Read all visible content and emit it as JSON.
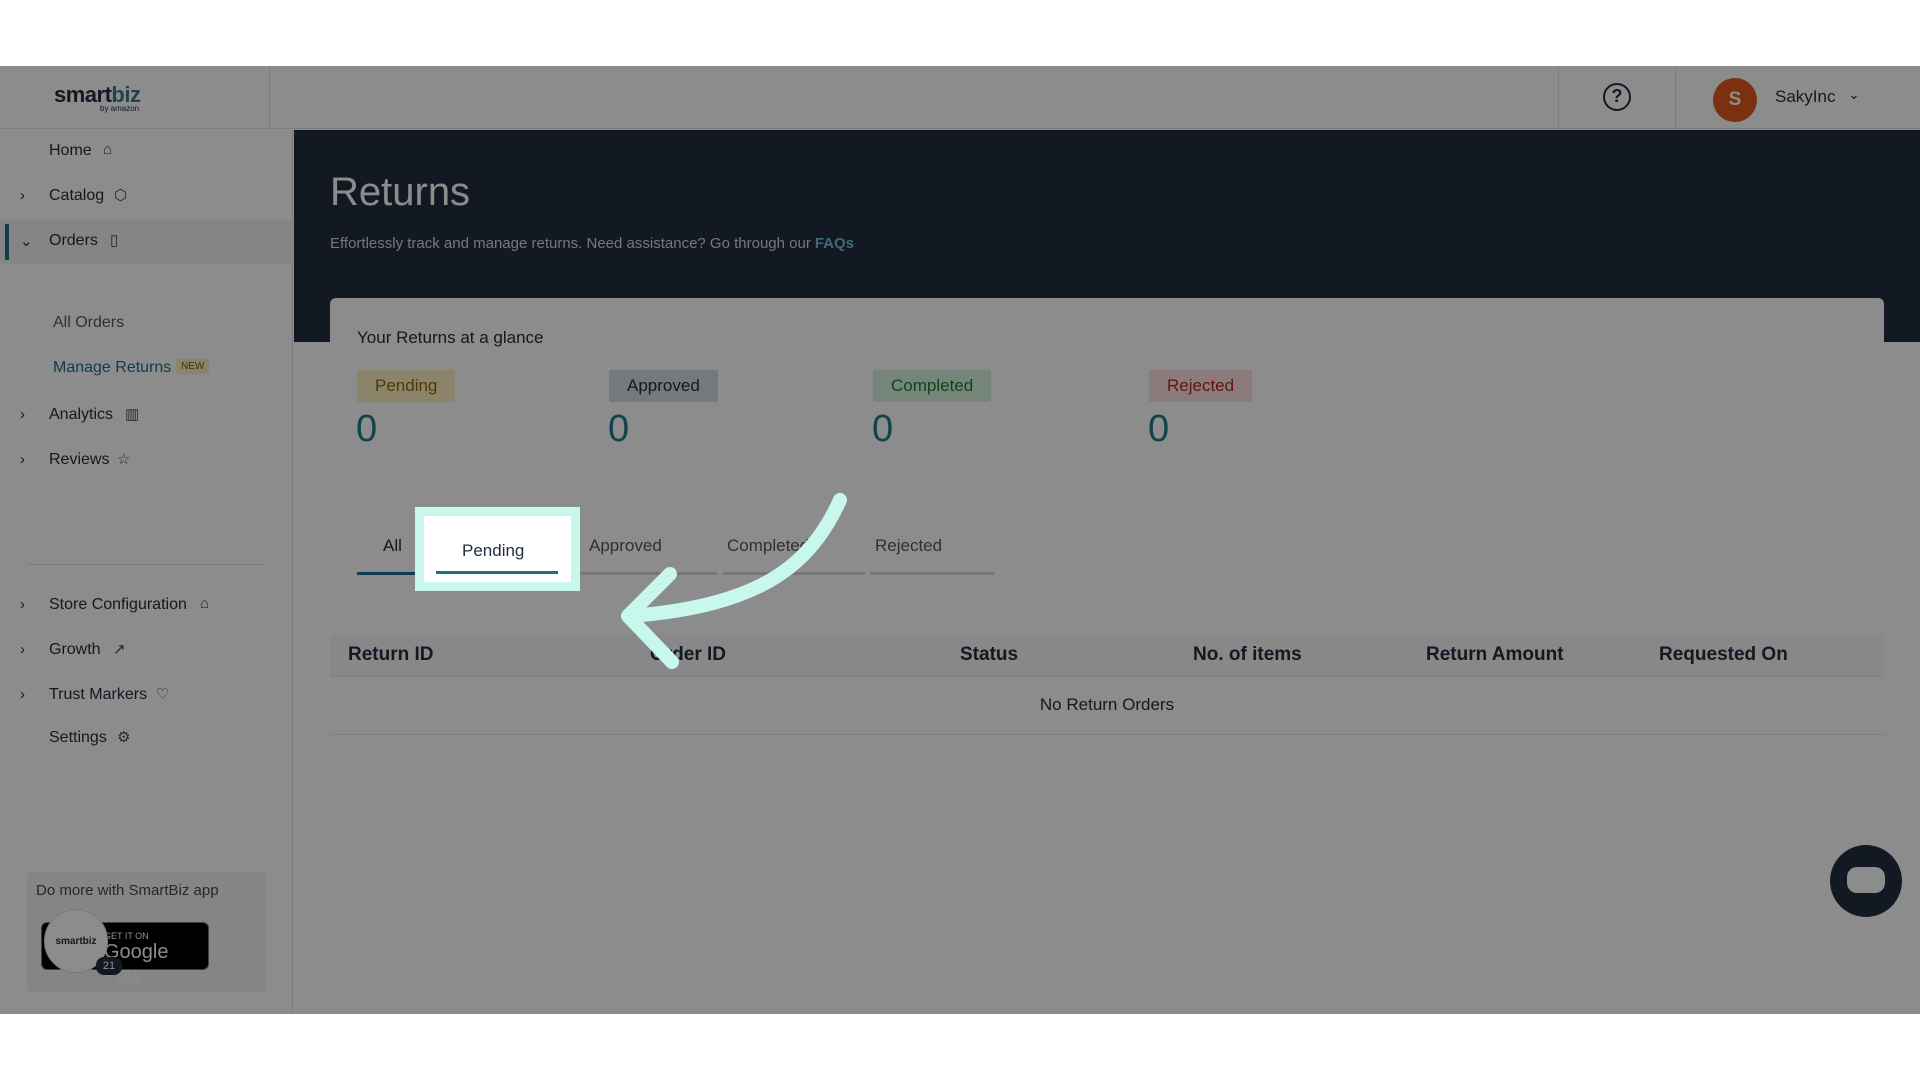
{
  "header": {
    "logo_main": "smart",
    "logo_accent": "biz",
    "logo_sub": "by amazon",
    "user_initial": "S",
    "user_name": "SakyInc"
  },
  "sidebar": {
    "items": [
      {
        "label": "Home",
        "icon": "home-icon"
      },
      {
        "label": "Catalog",
        "icon": "cube-icon"
      },
      {
        "label": "Orders",
        "icon": "clipboard-icon"
      },
      {
        "label": "Analytics",
        "icon": "bar-chart-icon"
      },
      {
        "label": "Reviews",
        "icon": "star-icon"
      },
      {
        "label": "Store Configuration",
        "icon": "store-icon"
      },
      {
        "label": "Growth",
        "icon": "trending-up-icon"
      },
      {
        "label": "Trust Markers",
        "icon": "shield-heart-icon"
      },
      {
        "label": "Settings",
        "icon": "gear-icon"
      }
    ],
    "sub_items": [
      "All Orders",
      "Manage Returns"
    ],
    "new_badge": "NEW",
    "app_promo": "Do more with SmartBiz app",
    "play_small": "GET IT ON",
    "play_big": "Google Play",
    "app_logo": "smartbiz",
    "app_count": "21"
  },
  "page": {
    "title": "Returns",
    "subtitle": "Effortlessly track and manage returns. Need assistance? Go through our",
    "faq_link": "FAQs"
  },
  "glance": {
    "title": "Your Returns at a glance",
    "stats": [
      {
        "label": "Pending",
        "value": "0",
        "color": "#fdf0c2"
      },
      {
        "label": "Approved",
        "value": "0",
        "color": "#d5dbe4"
      },
      {
        "label": "Completed",
        "value": "0",
        "color": "#d8f2dc"
      },
      {
        "label": "Rejected",
        "value": "0",
        "color": "#fde0e0"
      }
    ]
  },
  "tabs": [
    "All",
    "Pending",
    "Approved",
    "Completed",
    "Rejected"
  ],
  "table": {
    "columns": [
      "Return ID",
      "Order ID",
      "Status",
      "No. of items",
      "Return Amount",
      "Requested On"
    ],
    "empty_text": "No Return Orders"
  },
  "colors": {
    "accent": "#1f6e8c",
    "hero": "#232f3e",
    "highlight": "#c8f7ee"
  }
}
